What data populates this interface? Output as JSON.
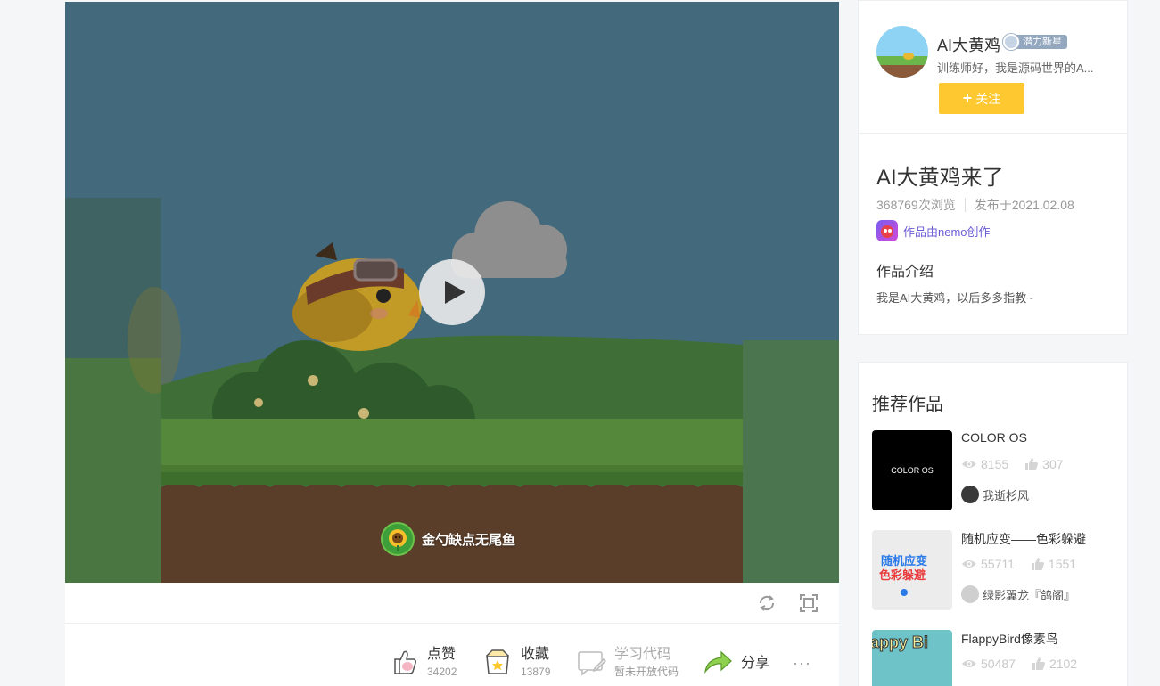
{
  "player": {
    "author_chip_name": "金勺缺点无尾鱼"
  },
  "actions": {
    "like": {
      "label": "点赞",
      "count": "34202"
    },
    "collect": {
      "label": "收藏",
      "count": "13879"
    },
    "learn": {
      "label": "学习代码",
      "sub": "暂未开放代码"
    },
    "share": {
      "label": "分享"
    },
    "more": "···"
  },
  "author": {
    "name": "AI大黄鸡",
    "badge": "潜力新星",
    "desc": "训练师好，我是源码世界的A...",
    "follow_label": "关注"
  },
  "work": {
    "title": "AI大黄鸡来了",
    "views": "368769次浏览",
    "published": "发布于2021.02.08",
    "made_by": "作品由nemo创作",
    "intro_heading": "作品介绍",
    "intro_text": "我是AI大黄鸡，以后多多指教~"
  },
  "recommend": {
    "heading": "推荐作品",
    "items": [
      {
        "title": "COLOR OS",
        "views": "8155",
        "likes": "307",
        "user": "我逝杉风",
        "thumb_text": "COLOR OS"
      },
      {
        "title": "随机应变——色彩躲避",
        "views": "55711",
        "likes": "1551",
        "user": "绿影翼龙『鸽阁』",
        "thumb_text_1": "随机应变",
        "thumb_text_2": "色彩躲避"
      },
      {
        "title": "FlappyBird像素鸟",
        "views": "50487",
        "likes": "2102",
        "user": "",
        "thumb_text": "appy Bi"
      }
    ]
  },
  "colors": {
    "accent_yellow": "#fdc830",
    "nemo_purple": "#6b5cd6",
    "sky": "#42697c"
  }
}
